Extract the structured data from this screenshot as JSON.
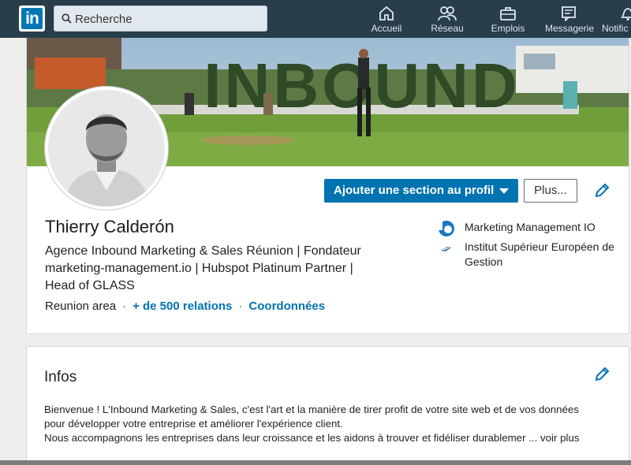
{
  "nav": {
    "logo_text": "in",
    "search_placeholder": "Recherche",
    "items": [
      {
        "label": "Accueil",
        "icon": "home-icon"
      },
      {
        "label": "Réseau",
        "icon": "network-icon"
      },
      {
        "label": "Emplois",
        "icon": "briefcase-icon"
      },
      {
        "label": "Messagerie",
        "icon": "messaging-icon"
      },
      {
        "label": "Notific",
        "icon": "bell-icon"
      }
    ]
  },
  "banner": {
    "sign_text": "INBOUND"
  },
  "profile": {
    "add_section_label": "Ajouter une section au profil",
    "more_label": "Plus...",
    "name": "Thierry Calderón",
    "headline_lines": [
      "Agence Inbound Marketing & Sales Réunion | Fondateur",
      "marketing-management.io | Hubspot Platinum Partner |",
      "Head of GLASS"
    ],
    "location": "Reunion area",
    "connections": "+ de 500 relations",
    "contact": "Coordonnées",
    "companies": [
      {
        "name": "Marketing Management IO",
        "icon": "company-logo-icon"
      },
      {
        "name": "Institut Supérieur Européen de Gestion",
        "icon": "school-logo-icon"
      }
    ]
  },
  "about": {
    "title": "Infos",
    "lines": [
      "Bienvenue ! L'Inbound Marketing & Sales, c'est l'art et la manière de tirer profit de votre site web et de vos données",
      "pour développer votre entreprise et améliorer l'expérience client.",
      "Nous accompagnons les entreprises dans leur croissance et les aidons à trouver et fidéliser durablemer"
    ],
    "see_more": "... voir plus"
  },
  "colors": {
    "nav_bg": "#283e4a",
    "brand_blue": "#0073b1",
    "page_bg": "#eeeeec"
  }
}
